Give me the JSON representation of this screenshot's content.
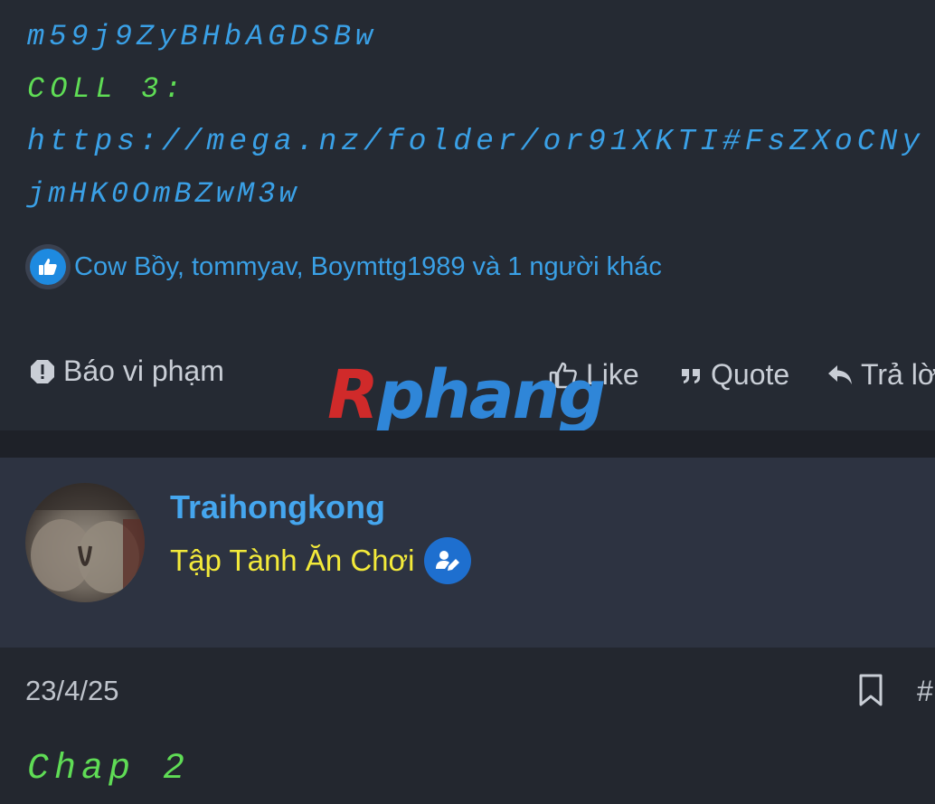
{
  "post": {
    "lines": [
      "m59j9ZyBHbAGDSBw",
      "COLL 3:",
      "https://mega.nz/folder/or91XKTI#FsZXoCNy",
      "jmHK0OmBZwM3w"
    ],
    "reactions_text": "Cow Bồy, tommyav, Boymttg1989 và 1 người khác",
    "actions": {
      "report": "Báo vi phạm",
      "like": "Like",
      "quote": "Quote",
      "reply": "Trả lời"
    }
  },
  "watermark": {
    "first": "R",
    "rest": "phang"
  },
  "user": {
    "name": "Traihongkong",
    "title": "Tập Tành Ăn Chơi"
  },
  "post2": {
    "date": "23/4/25",
    "hash": "#",
    "content": "Chap 2"
  },
  "colors": {
    "link_blue": "#3aa0e6",
    "code_green": "#5fdc55",
    "title_yellow": "#f3ea3a",
    "background": "#23272f"
  }
}
